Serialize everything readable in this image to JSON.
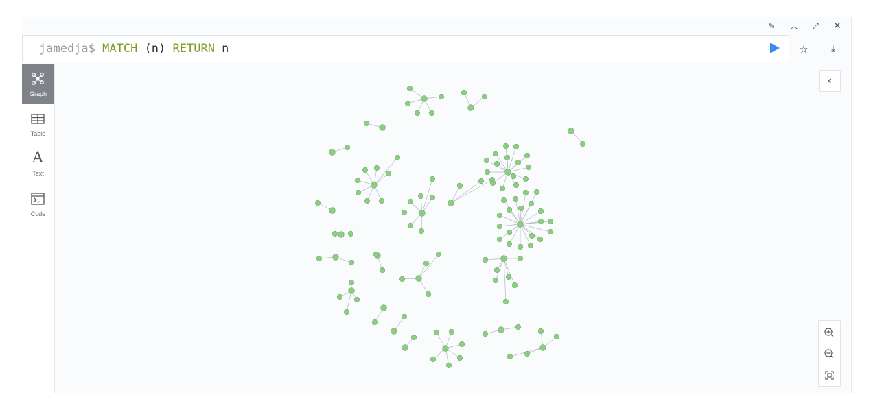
{
  "window_controls": {
    "pin": "pin-icon",
    "collapse": "chevron-up-icon",
    "expand": "expand-icon",
    "close": "close-icon"
  },
  "editor": {
    "prompt": "jamedja$",
    "query_parts": [
      {
        "text": "MATCH",
        "kind": "keyword"
      },
      {
        "text": " (n) ",
        "kind": "plain"
      },
      {
        "text": "RETURN",
        "kind": "keyword"
      },
      {
        "text": " n",
        "kind": "plain"
      }
    ],
    "run_icon": "play-icon",
    "favorite_icon": "star-icon",
    "download_icon": "download-icon"
  },
  "sidebar": {
    "items": [
      {
        "label": "Graph",
        "icon": "graph-icon",
        "active": true
      },
      {
        "label": "Table",
        "icon": "table-icon",
        "active": false
      },
      {
        "label": "Text",
        "icon": "text-icon",
        "active": false
      },
      {
        "label": "Code",
        "icon": "code-icon",
        "active": false
      }
    ]
  },
  "graph": {
    "node_color": "#8fcb84",
    "edge_color": "#b4bac2"
  },
  "canvas_controls": {
    "collapse": "chevron-left-icon",
    "zoom_in": "zoom-in-icon",
    "zoom_out": "zoom-out-icon",
    "fit": "fit-to-screen-icon"
  },
  "colors": {
    "keyword": "#7a9c24",
    "run": "#3a8cf0",
    "active_tab": "#7f8289",
    "background": "#f9fbfd"
  }
}
